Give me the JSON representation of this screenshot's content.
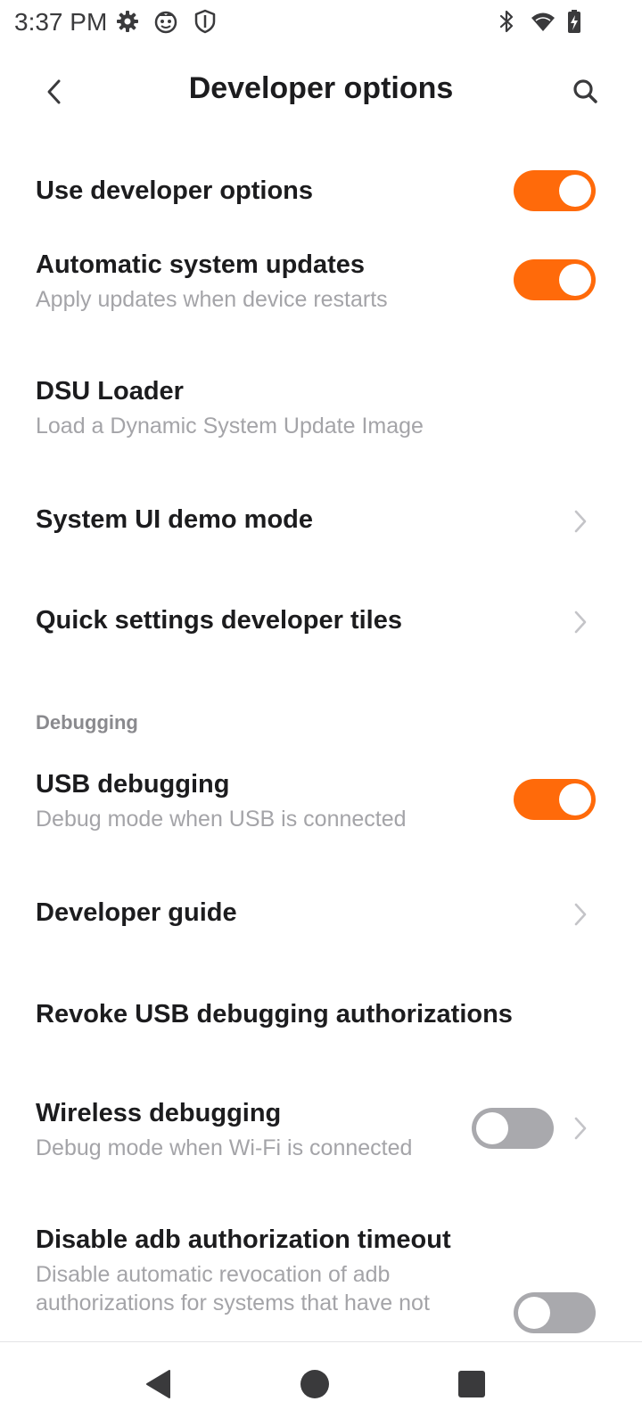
{
  "status_bar": {
    "time": "3:37 PM",
    "left_icons": [
      "gear-icon",
      "face-icon",
      "shield-icon"
    ],
    "right_icons": [
      "bluetooth-icon",
      "wifi-icon",
      "battery-charging-icon"
    ]
  },
  "header": {
    "title": "Developer options",
    "back_icon": "chevron-left-icon",
    "search_icon": "search-icon"
  },
  "colors": {
    "accent": "#ff6a0a",
    "toggle_off": "#a9a9ad",
    "title_text": "#1c1c1e",
    "subtitle_text": "#a4a4a8",
    "section_text": "#8a8a8e"
  },
  "settings": {
    "use_developer_options": {
      "title": "Use developer options",
      "enabled": true
    },
    "automatic_system_updates": {
      "title": "Automatic system updates",
      "subtitle": "Apply updates when device restarts",
      "enabled": true
    },
    "dsu_loader": {
      "title": "DSU Loader",
      "subtitle": "Load a Dynamic System Update Image"
    },
    "system_ui_demo_mode": {
      "title": "System UI demo mode"
    },
    "quick_settings_tiles": {
      "title": "Quick settings developer tiles"
    },
    "debugging_section": {
      "title": "Debugging"
    },
    "usb_debugging": {
      "title": "USB debugging",
      "subtitle": "Debug mode when USB is connected",
      "enabled": true
    },
    "developer_guide": {
      "title": "Developer guide"
    },
    "revoke_usb_auth": {
      "title": "Revoke USB debugging authorizations"
    },
    "wireless_debugging": {
      "title": "Wireless debugging",
      "subtitle": "Debug mode when Wi-Fi is connected",
      "enabled": false
    },
    "disable_adb_timeout": {
      "title": "Disable adb authorization timeout",
      "subtitle": "Disable automatic revocation of adb authorizations for systems that have not",
      "enabled": false
    }
  },
  "nav_bar": {
    "back_icon": "triangle-back-icon",
    "home_icon": "circle-home-icon",
    "recents_icon": "square-recents-icon"
  }
}
